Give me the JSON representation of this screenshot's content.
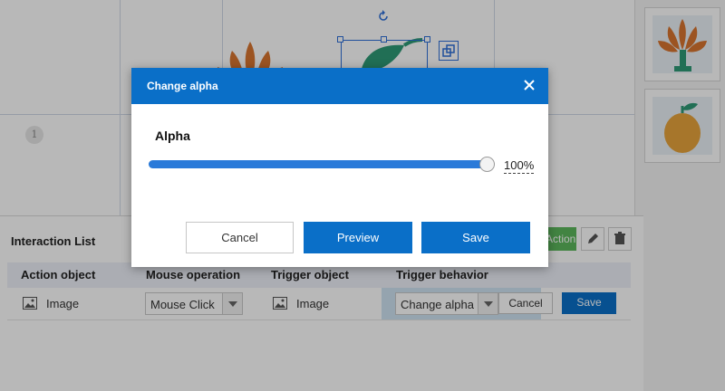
{
  "canvas": {
    "page_number": "1"
  },
  "interaction_list": {
    "title": "Interaction List",
    "add_action_label": "Action",
    "columns": [
      "Action object",
      "Mouse operation",
      "Trigger object",
      "Trigger behavior"
    ],
    "row": {
      "action_object": "Image",
      "mouse_operation": "Mouse Click",
      "trigger_object": "Image",
      "trigger_behavior": "Change alpha",
      "cancel_label": "Cancel",
      "save_label": "Save"
    }
  },
  "dialog": {
    "title": "Change alpha",
    "alpha_label": "Alpha",
    "alpha_percent": 100,
    "alpha_display": "100%",
    "cancel_label": "Cancel",
    "preview_label": "Preview",
    "save_label": "Save"
  },
  "colors": {
    "primary": "#0a6fc8",
    "slider_fill": "#2a7ad9",
    "success": "#5cb85c",
    "leaf_orange": "#d87530",
    "leaf_green": "#2f9a76",
    "orange_fruit": "#e8a43c"
  },
  "icons": [
    "rotate-icon",
    "crop-icon",
    "image-icon",
    "edit-icon",
    "trash-icon",
    "close-icon",
    "tree-icon",
    "orange-icon",
    "leaf-icon"
  ]
}
